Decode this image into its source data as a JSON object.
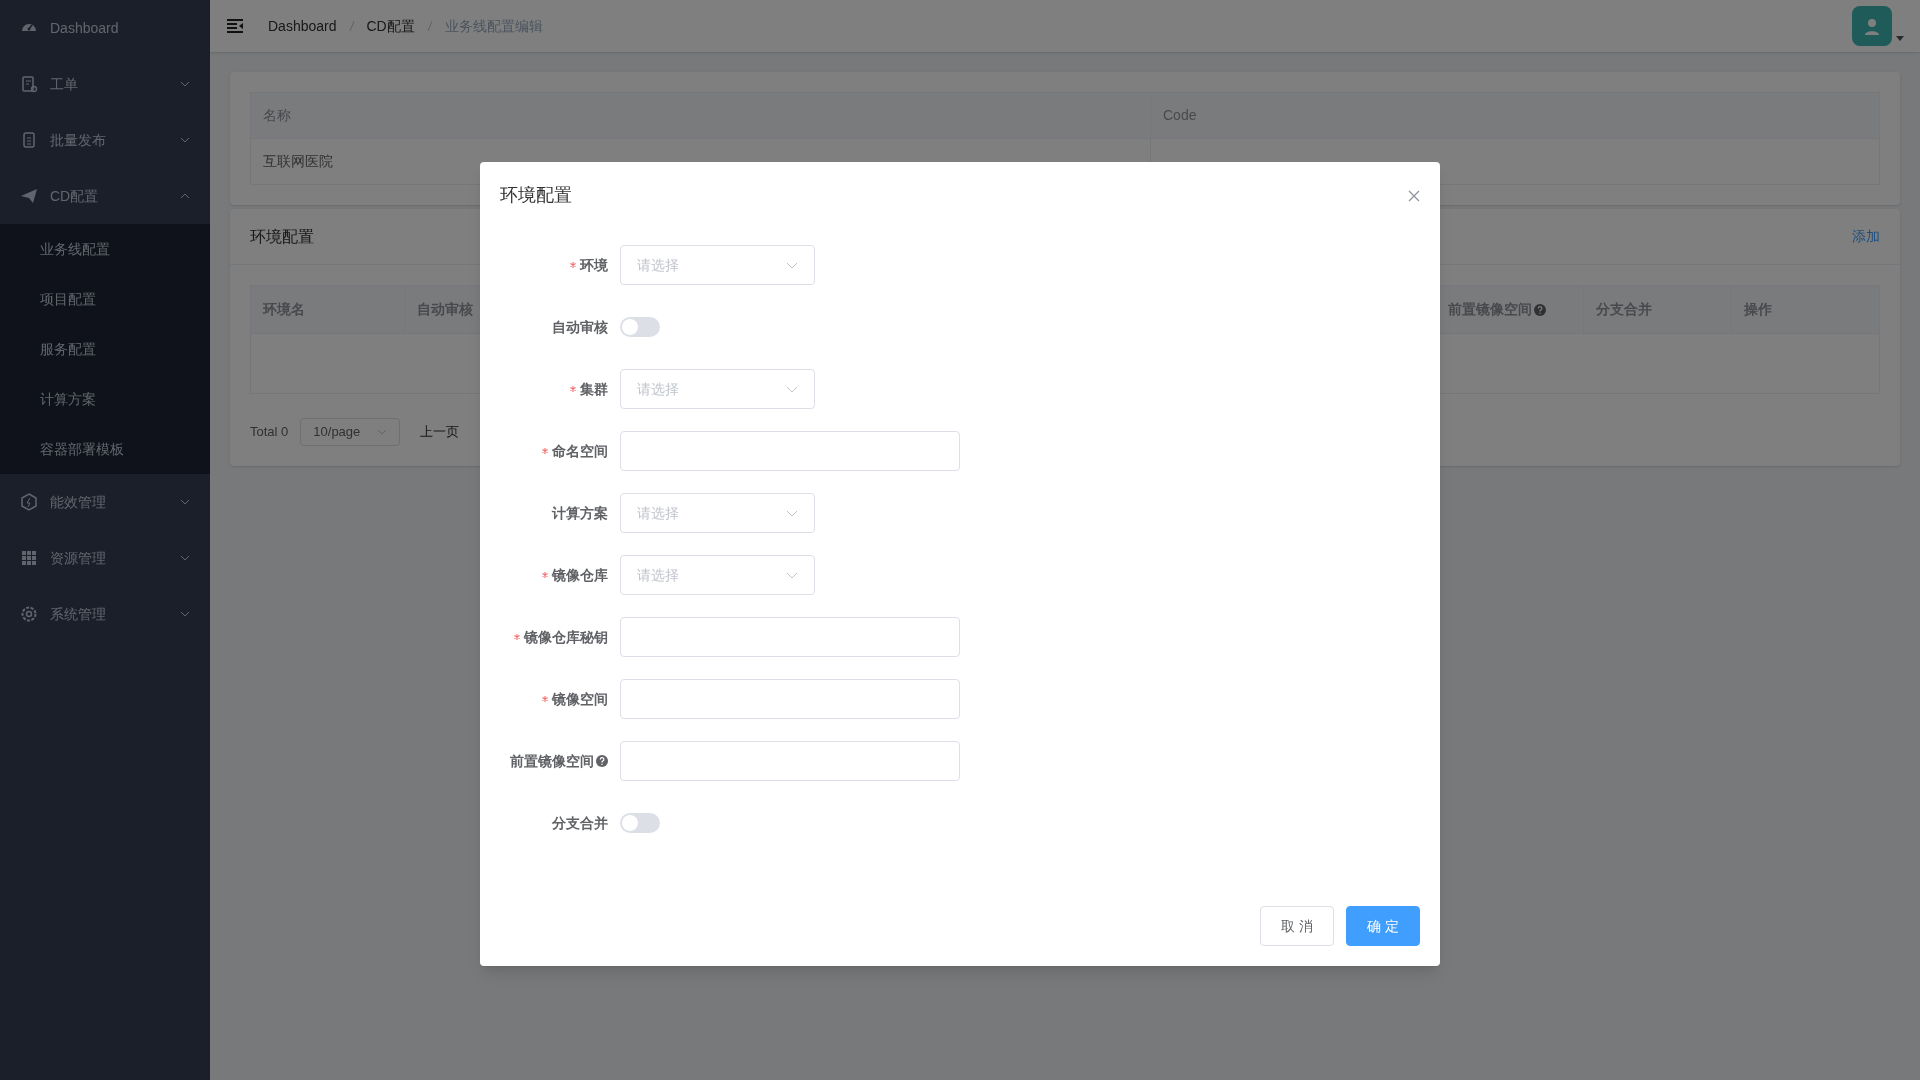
{
  "sidebar": {
    "items": [
      {
        "label": "Dashboard"
      },
      {
        "label": "工单",
        "expanded": false
      },
      {
        "label": "批量发布",
        "expanded": false
      },
      {
        "label": "CD配置",
        "expanded": true,
        "children": [
          {
            "label": "业务线配置"
          },
          {
            "label": "项目配置"
          },
          {
            "label": "服务配置"
          },
          {
            "label": "计算方案"
          },
          {
            "label": "容器部署模板"
          }
        ]
      },
      {
        "label": "能效管理",
        "expanded": false
      },
      {
        "label": "资源管理",
        "expanded": false
      },
      {
        "label": "系统管理",
        "expanded": false
      }
    ]
  },
  "breadcrumb": [
    "Dashboard",
    "CD配置",
    "业务线配置编辑"
  ],
  "info_table": {
    "columns": [
      "名称",
      "Code"
    ],
    "rows": [
      [
        "互联网医院"
      ]
    ]
  },
  "env_section": {
    "title": "环境配置",
    "add_link": "添加",
    "columns": [
      {
        "label": "环境名",
        "help": false
      },
      {
        "label": "自动审核",
        "help": false
      },
      {
        "label": "前置镜像空间",
        "help": true
      },
      {
        "label": "分支合并",
        "help": false
      },
      {
        "label": "操作",
        "help": false
      }
    ],
    "pagination": {
      "total": "Total 0",
      "page_size": "10/page",
      "prev": "上一页"
    }
  },
  "dialog": {
    "title": "环境配置",
    "fields": [
      {
        "kind": "select",
        "label": "环境",
        "required": true,
        "help": false,
        "placeholder": "请选择"
      },
      {
        "kind": "switch",
        "label": "自动审核",
        "required": false,
        "help": false,
        "on": false
      },
      {
        "kind": "select",
        "label": "集群",
        "required": true,
        "help": false,
        "placeholder": "请选择"
      },
      {
        "kind": "input",
        "label": "命名空间",
        "required": true,
        "help": false
      },
      {
        "kind": "select",
        "label": "计算方案",
        "required": false,
        "help": false,
        "placeholder": "请选择"
      },
      {
        "kind": "select",
        "label": "镜像仓库",
        "required": true,
        "help": false,
        "placeholder": "请选择"
      },
      {
        "kind": "input",
        "label": "镜像仓库秘钥",
        "required": true,
        "help": false
      },
      {
        "kind": "input",
        "label": "镜像空间",
        "required": true,
        "help": false
      },
      {
        "kind": "input",
        "label": "前置镜像空间",
        "required": false,
        "help": true
      },
      {
        "kind": "switch",
        "label": "分支合并",
        "required": false,
        "help": false,
        "on": false
      }
    ],
    "buttons": [
      {
        "label": "取 消",
        "kind": "default"
      },
      {
        "label": "确 定",
        "kind": "primary"
      }
    ]
  }
}
